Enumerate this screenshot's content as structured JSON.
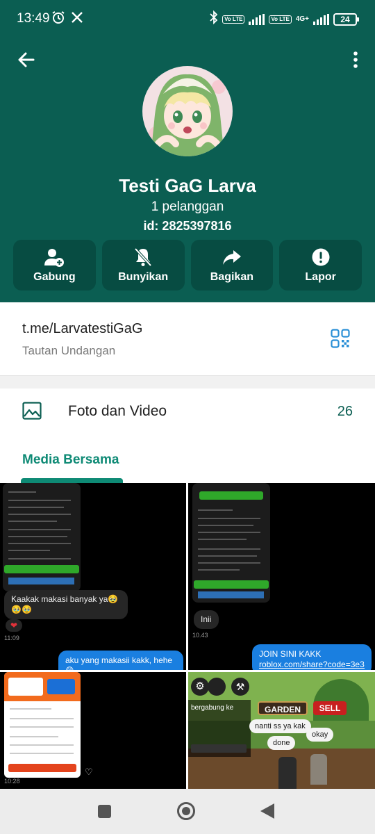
{
  "status_bar": {
    "time": "13:49",
    "battery": "24",
    "network_label": "4G+",
    "volte_label": "Vo LTE"
  },
  "channel": {
    "title": "Testi GaG Larva",
    "subscribers": "1 pelanggan",
    "id": "id: 2825397816"
  },
  "actions": [
    {
      "label": "Gabung",
      "icon": "add-person-icon"
    },
    {
      "label": "Bunyikan",
      "icon": "bell-off-icon"
    },
    {
      "label": "Bagikan",
      "icon": "share-arrow-icon"
    },
    {
      "label": "Lapor",
      "icon": "alert-icon"
    }
  ],
  "invite": {
    "link": "t.me/LarvatestiGaG",
    "caption": "Tautan Undangan"
  },
  "media": {
    "label": "Foto dan Video",
    "count": "26",
    "tab": "Media Bersama"
  },
  "tiles": {
    "t1_bubble_in": "Kaakak makasi banyak ya🥹🥹🥹",
    "t1_time": "11:09",
    "t1_bubble_out": "aku yang makasii kakk, hehe 😁",
    "t2_bubble_in": "Inii",
    "t2_time": "10.43",
    "t2_bubble_out_line1": "JOIN SINI KAKK",
    "t2_bubble_out_line2": "roblox.com/share?code=3e3...",
    "t3_time": "10:28",
    "t4_garden": "GARDEN",
    "t4_sell": "SELL",
    "t4_join_text": "bergabung ke",
    "t4_bubble1": "nanti ss ya kak",
    "t4_bubble2": "okay",
    "t4_bubble3": "done"
  },
  "colors": {
    "header_green": "#0b5e52",
    "button_green": "#074c42",
    "accent_teal": "#0e8a75",
    "link_blue_icon": "#2a8fd6"
  }
}
